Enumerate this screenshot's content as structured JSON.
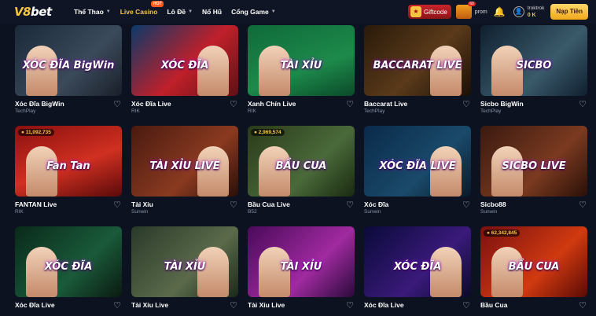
{
  "logo": {
    "part1": "V8",
    "part2": "bet"
  },
  "nav": [
    {
      "label": "Thể Thao",
      "chev": "⌄",
      "active": false
    },
    {
      "label": "Live Casino",
      "chev": "",
      "active": true,
      "hot": "HOT"
    },
    {
      "label": "Lô Đề",
      "chev": "⌄",
      "active": false
    },
    {
      "label": "Nổ Hũ",
      "chev": "",
      "active": false
    },
    {
      "label": "Cổng Game",
      "chev": "⌄",
      "active": false
    }
  ],
  "header": {
    "giftcode": "Giftcode",
    "promo_count": "60",
    "promo_label": "prom",
    "username": "troktrok",
    "balance": "0 K",
    "deposit": "Nạp Tiền"
  },
  "games": [
    {
      "name": "Xóc Đĩa BigWin",
      "provider": "TechPlay",
      "art": "XÓC ĐĨA BigWin",
      "theme": "g1"
    },
    {
      "name": "Xóc Đĩa Live",
      "provider": "RIK",
      "art": "XÓC ĐĨA",
      "theme": "g2"
    },
    {
      "name": "Xanh Chín Live",
      "provider": "RIK",
      "art": "TÀI  XỈU",
      "theme": "g3"
    },
    {
      "name": "Baccarat Live",
      "provider": "TechPlay",
      "art": "BACCARAT LIVE",
      "theme": "g4"
    },
    {
      "name": "Sicbo BigWin",
      "provider": "TechPlay",
      "art": "SICBO",
      "theme": "g5"
    },
    {
      "name": "FANTAN Live",
      "provider": "RIK",
      "art": "Fan Tan",
      "badge": "11,092,735",
      "theme": "g6"
    },
    {
      "name": "Tài Xỉu",
      "provider": "Sunwin",
      "art": "TÀI XỈU LIVE",
      "theme": "g7"
    },
    {
      "name": "Bầu Cua Live",
      "provider": "B52",
      "art": "BẦU CUA",
      "badge": "2,969,574",
      "theme": "g8"
    },
    {
      "name": "Xóc Đĩa",
      "provider": "Sunwin",
      "art": "XÓC ĐĨA LIVE",
      "theme": "g9"
    },
    {
      "name": "Sicbo88",
      "provider": "Sunwin",
      "art": "SICBO LIVE",
      "theme": "g10"
    },
    {
      "name": "Xóc Đĩa Live",
      "provider": "",
      "art": "XÓC ĐĨA",
      "theme": "g11"
    },
    {
      "name": "Tài Xỉu Live",
      "provider": "",
      "art": "TÀI XỈU",
      "theme": "g12"
    },
    {
      "name": "Tài Xỉu Live",
      "provider": "",
      "art": "TÀI XỈU",
      "theme": "g13"
    },
    {
      "name": "Xóc Đĩa Live",
      "provider": "",
      "art": "XÓC ĐĨA",
      "theme": "g14"
    },
    {
      "name": "Bầu Cua",
      "provider": "",
      "art": "BẦU CUA",
      "badge": "62,342,845",
      "theme": "g15"
    }
  ]
}
